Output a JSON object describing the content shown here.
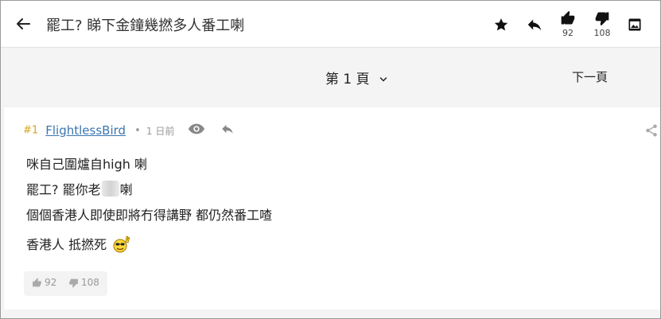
{
  "header": {
    "title": "罷工? 睇下金鐘幾撚多人番工喇",
    "like_count": "92",
    "dislike_count": "108"
  },
  "pager": {
    "current_page": "第 1 頁",
    "next_page": "下一頁"
  },
  "post": {
    "floor": "#1",
    "username": "FlightlessBird",
    "dot": "•",
    "time": "1 日前",
    "lines": [
      "咪自己圍爐自high 喇",
      "罷工? 罷你老",
      "喇",
      "個個香港人即使即將冇得講野 都仍然番工喳",
      "香港人 抵撚死"
    ],
    "votes": {
      "like": "92",
      "dislike": "108"
    }
  },
  "colors": {
    "accent_link": "#3a76b0",
    "floor_number": "#d6a522",
    "muted": "#999999"
  },
  "icons": [
    "back-arrow-icon",
    "star-icon",
    "reply-icon",
    "thumbs-up-icon",
    "thumbs-down-icon",
    "image-icon",
    "chevron-down-icon",
    "eye-icon",
    "share-icon",
    "emoji-icon"
  ]
}
